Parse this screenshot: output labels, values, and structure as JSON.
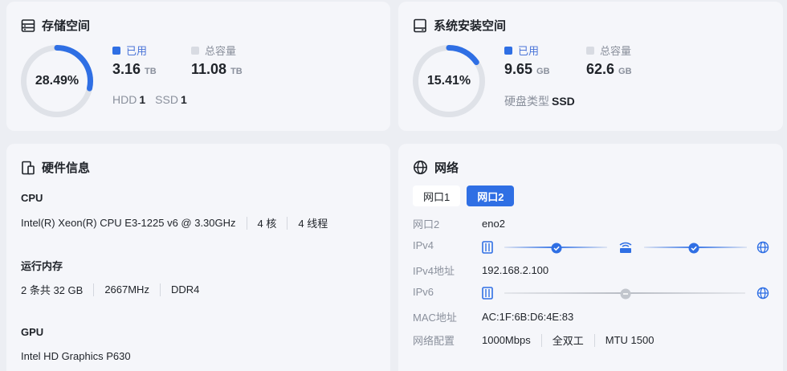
{
  "storage": {
    "title": "存储空间",
    "percent_text": "28.49%",
    "percent": 28.49,
    "used_label": "已用",
    "used_value": "3.16",
    "used_unit": "TB",
    "total_label": "总容量",
    "total_value": "11.08",
    "total_unit": "TB",
    "hdd_label": "HDD",
    "hdd_count": "1",
    "ssd_label": "SSD",
    "ssd_count": "1"
  },
  "system": {
    "title": "系统安装空间",
    "percent_text": "15.41%",
    "percent": 15.41,
    "used_label": "已用",
    "used_value": "9.65",
    "used_unit": "GB",
    "total_label": "总容量",
    "total_value": "62.6",
    "total_unit": "GB",
    "disk_type_label": "硬盘类型",
    "disk_type_value": "SSD"
  },
  "hardware": {
    "title": "硬件信息",
    "cpu_title": "CPU",
    "cpu_model": "Intel(R) Xeon(R) CPU E3-1225 v6 @ 3.30GHz",
    "cpu_cores": "4 核",
    "cpu_threads": "4 线程",
    "mem_title": "运行内存",
    "mem_size": "2 条共 32 GB",
    "mem_speed": "2667MHz",
    "mem_type": "DDR4",
    "gpu_title": "GPU",
    "gpu_model": "Intel HD Graphics P630"
  },
  "network": {
    "title": "网络",
    "tabs": [
      "网口1",
      "网口2"
    ],
    "active_tab": "网口2",
    "port_label": "网口2",
    "port_value": "eno2",
    "ipv4_label": "IPv4",
    "ipv4_addr_label": "IPv4地址",
    "ipv4_addr_value": "192.168.2.100",
    "ipv6_label": "IPv6",
    "mac_label": "MAC地址",
    "mac_value": "AC:1F:6B:D6:4E:83",
    "config_label": "网络配置",
    "config_speed": "1000Mbps",
    "config_duplex": "全双工",
    "config_mtu": "MTU 1500"
  },
  "colors": {
    "accent": "#2f6fe4",
    "ring_track": "#dfe2e8",
    "muted": "#8a909c"
  }
}
